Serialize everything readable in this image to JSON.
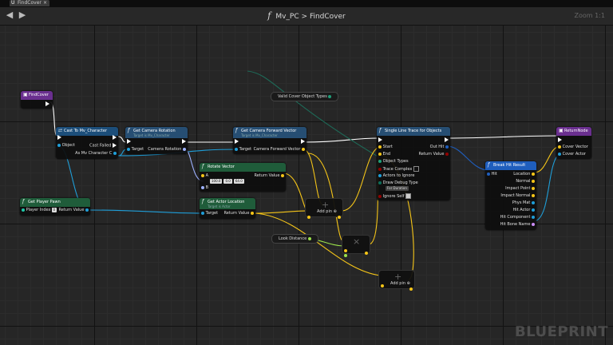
{
  "tab": {
    "title": "FindCover"
  },
  "breadcrumb": {
    "blueprint": "Mv_PC",
    "separator": ">",
    "function": "FindCover"
  },
  "zoom": "Zoom 1:1",
  "watermark": "BLUEPRINT",
  "nodes": {
    "find_cover": {
      "title": "FindCover"
    },
    "cast": {
      "title": "Cast To Mv_Character",
      "pin_object": "Object",
      "pin_cast_failed": "Cast Failed",
      "pin_as": "As Mv Character C"
    },
    "get_cam_rot": {
      "title": "Get Camera Rotation",
      "subtitle": "Target is Mv_Character",
      "pin_target": "Target",
      "pin_out": "Camera Rotation"
    },
    "get_cam_fwd": {
      "title": "Get Camera Forward Vector",
      "subtitle": "Target is Mv_Character",
      "pin_target": "Target",
      "pin_out": "Camera Forward Vector"
    },
    "rotate_vec": {
      "title": "Rotate Vector",
      "pin_a": "A",
      "a_x": "100.0",
      "a_y": "0.0",
      "a_z": "64.0",
      "pin_b": "B",
      "pin_out": "Return Value"
    },
    "get_player_pawn": {
      "title": "Get Player Pawn",
      "pin_index": "Player Index",
      "index_val": "0",
      "pin_out": "Return Value"
    },
    "get_actor_loc": {
      "title": "Get Actor Location",
      "subtitle": "Target is Actor",
      "pin_target": "Target",
      "pin_out": "Return Value"
    },
    "valid_cover": {
      "label": "Valid Cover Object Types"
    },
    "look_distance": {
      "label": "Look Distance"
    },
    "add_pin_1": {
      "label": "Add pin"
    },
    "add_pin_2": {
      "label": "Add pin"
    },
    "line_trace": {
      "title": "Single Line Trace for Objects",
      "start": "Start",
      "end": "End",
      "object_types": "Object Types",
      "trace_complex": "Trace Complex",
      "actors_ignore": "Actors to Ignore",
      "draw_debug": "Draw Debug Type",
      "draw_debug_val": "For Duration",
      "ignore_self": "Ignore Self",
      "out_hit": "Out Hit",
      "return_value": "Return Value"
    },
    "break_hit": {
      "title": "Break Hit Result",
      "hit": "Hit",
      "pins": [
        "Location",
        "Normal",
        "Impact Point",
        "Impact Normal",
        "Phys Mat",
        "Hit Actor",
        "Hit Component",
        "Hit Bone Name"
      ]
    },
    "return_node": {
      "title": "ReturnNode",
      "pin_cover_vec": "Cover Vector",
      "pin_cover_actor": "Cover Actor"
    }
  },
  "colors": {
    "function_header": "#6a2f8f",
    "pure_header": "#1f5c3a",
    "cast_header": "#1c4e7a",
    "call_header": "#264e73",
    "object_pin": "#1f9ed8",
    "vector_pin": "#f5c518",
    "struct_pin": "#1f5ebd",
    "float_pin": "#9ce34a",
    "bool_pin": "#920000"
  }
}
